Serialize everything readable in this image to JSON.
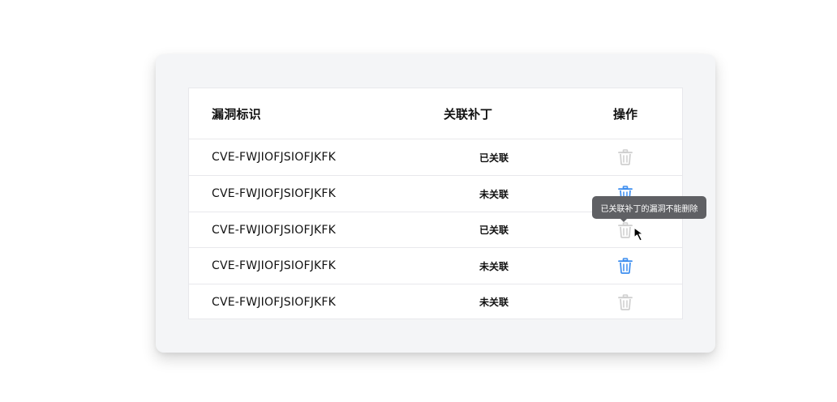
{
  "table": {
    "headers": {
      "id": "漏洞标识",
      "patch": "关联补丁",
      "action": "操作"
    },
    "rows": [
      {
        "id": "CVE-FWJIOFJSIOFJKFK",
        "status": "已关联",
        "delete_enabled": false
      },
      {
        "id": "CVE-FWJIOFJSIOFJKFK",
        "status": "未关联",
        "delete_enabled": true
      },
      {
        "id": "CVE-FWJIOFJSIOFJKFK",
        "status": "已关联",
        "delete_enabled": false
      },
      {
        "id": "CVE-FWJIOFJSIOFJKFK",
        "status": "未关联",
        "delete_enabled": true
      },
      {
        "id": "CVE-FWJIOFJSIOFJKFK",
        "status": "未关联",
        "delete_enabled": false
      }
    ]
  },
  "tooltip": {
    "text": "已关联补丁的漏洞不能删除"
  },
  "colors": {
    "trash_enabled": "#3d8ef0",
    "trash_disabled": "#cfcfcf",
    "tooltip_bg": "#5f6064"
  },
  "icons": {
    "delete": "trash-icon",
    "pointer": "cursor-arrow-icon"
  }
}
